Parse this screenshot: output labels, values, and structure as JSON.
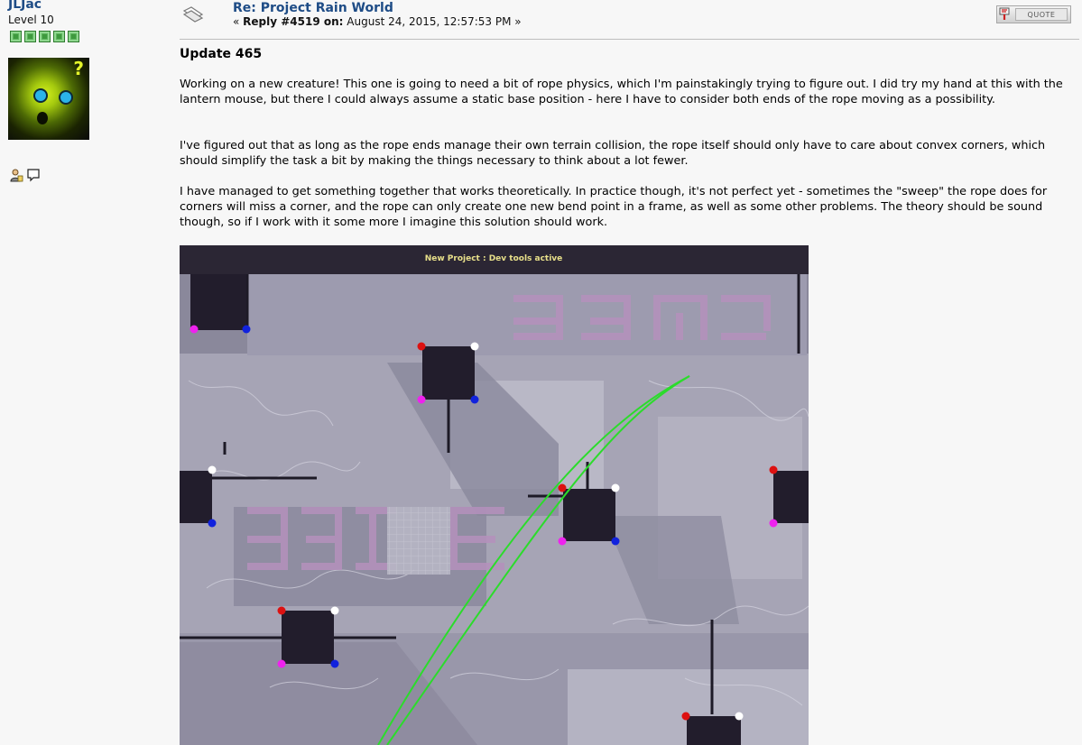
{
  "poster": {
    "name": "JLJac",
    "level": "Level 10",
    "stars": 5,
    "avatar_alt": "?"
  },
  "message": {
    "title": "Re: Project Rain World",
    "meta_prefix": "« ",
    "reply_label": "Reply #4519 on:",
    "timestamp": " August 24, 2015, 12:57:53 PM »",
    "quote_label": "QUOTE"
  },
  "post": {
    "heading": "Update 465",
    "paragraphs": [
      "Working on a new creature! This one is going to need a bit of rope physics, which I'm painstakingly trying to figure out. I did try my hand at this with the lantern mouse, but there I could always assume a static base position - here I have to consider both ends of the rope moving as a possibility.",
      "I've figured out that as long as the rope ends manage their own terrain collision, the rope itself should only have to care about convex corners, which should simplify the task a bit by making the things necessary to think about a lot fewer.",
      "I have managed to get something together that works theoretically. In practice though, it's not perfect yet - sometimes the \"sweep\" the rope does for corners will miss a corner, and the rope can only create one new bend point in a frame, as well as some other problems. The theory should be sound though, so if I work with it some more I imagine this solution should work."
    ]
  },
  "screenshot": {
    "banner": "New Project : Dev tools active"
  },
  "icons": {
    "message": "message-icon",
    "profile": "profile-icon",
    "pm": "pm-icon",
    "quote": "quote-icon"
  }
}
